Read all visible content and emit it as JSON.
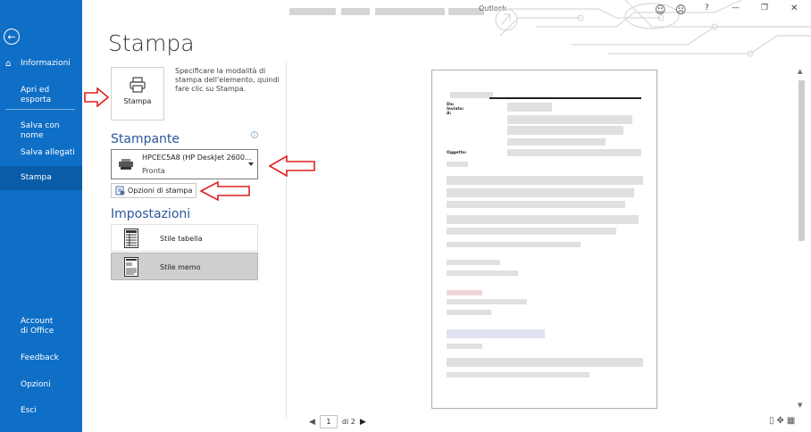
{
  "window": {
    "app_name": "Outlook",
    "controls": {
      "smile": "☺",
      "frown": "☹",
      "help": "?",
      "minimize": "—",
      "restore": "❐",
      "close": "✕"
    }
  },
  "sidebar": {
    "back_icon": "back-arrow-icon",
    "items": [
      {
        "label": "Informazioni",
        "icon": "home-icon"
      },
      {
        "label": "Apri ed esporta"
      },
      {
        "label": "Salva con nome"
      },
      {
        "label": "Salva allegati"
      },
      {
        "label": "Stampa",
        "selected": true
      },
      {
        "label": "Account di Office"
      },
      {
        "label": "Feedback"
      },
      {
        "label": "Opzioni"
      },
      {
        "label": "Esci"
      }
    ]
  },
  "main": {
    "title": "Stampa",
    "print_button": {
      "label": "Stampa",
      "icon": "printer-icon"
    },
    "print_description": "Specificare la modalità di stampa dell'elemento, quindi fare clic su Stampa.",
    "printer_section": {
      "heading": "Stampante",
      "selected_printer": "HPCEC5A8 (HP DeskJet 2600...",
      "printer_status": "Pronta",
      "print_options_label": "Opzioni di stampa"
    },
    "settings_section": {
      "heading": "Impostazioni",
      "styles": [
        {
          "label": "Stile tabella",
          "icon": "table-style-icon",
          "selected": false
        },
        {
          "label": "Stile memo",
          "icon": "memo-style-icon",
          "selected": true
        }
      ]
    }
  },
  "preview": {
    "fields": [
      "Da:",
      "Inviato:",
      "A:",
      "Oggetto:"
    ],
    "pager": {
      "current_page": "1",
      "of_label": "di 2"
    }
  },
  "colors": {
    "sidebar_bg": "#0f6fc6",
    "accent": "#2b579a",
    "annotation_red": "#e02020"
  }
}
